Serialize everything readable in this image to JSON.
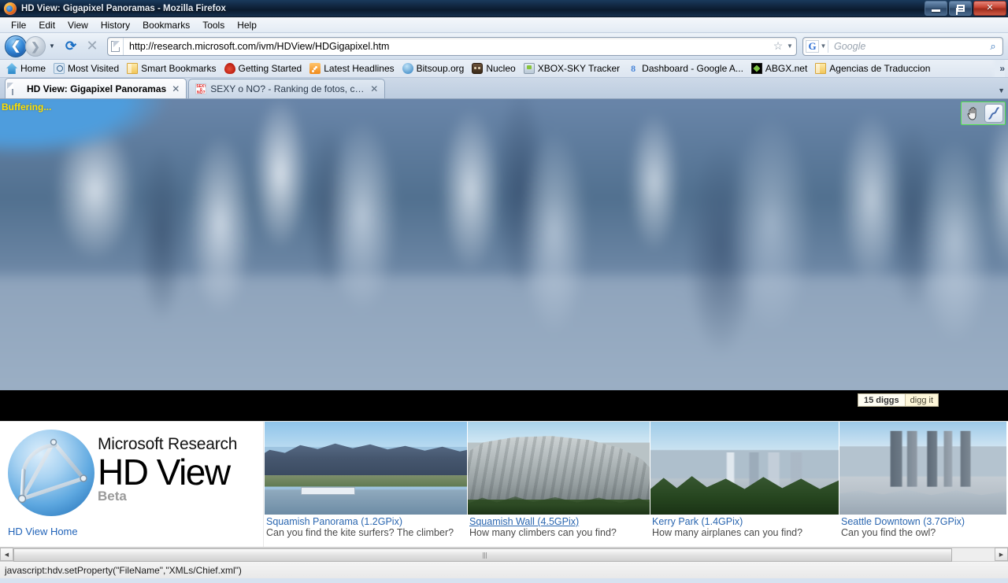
{
  "window": {
    "title": "HD View: Gigapixel Panoramas - Mozilla Firefox",
    "minimize_label": "Minimize",
    "restore_label": "Restore",
    "close_label": "✕"
  },
  "menubar": {
    "items": [
      {
        "label": "File"
      },
      {
        "label": "Edit"
      },
      {
        "label": "View"
      },
      {
        "label": "History"
      },
      {
        "label": "Bookmarks"
      },
      {
        "label": "Tools"
      },
      {
        "label": "Help"
      }
    ]
  },
  "toolbar": {
    "back_glyph": "❮",
    "forward_glyph": "❯",
    "dropdown_glyph": "▼",
    "reload_glyph": "⟳",
    "stop_glyph": "✕",
    "url": "http://research.microsoft.com/ivm/HDView/HDGigapixel.htm",
    "star_glyph": "☆",
    "star_caret": "▼",
    "search_engine": "G",
    "search_caret": "▼",
    "search_placeholder": "Google",
    "search_glyph": "⌕"
  },
  "bookmarks": {
    "items": [
      {
        "label": "Home",
        "icon": "home-icon"
      },
      {
        "label": "Most Visited",
        "icon": "magnifier-icon"
      },
      {
        "label": "Smart Bookmarks",
        "icon": "folder-icon"
      },
      {
        "label": "Getting Started",
        "icon": "flame-icon"
      },
      {
        "label": "Latest Headlines",
        "icon": "rss-icon"
      },
      {
        "label": "Bitsoup.org",
        "icon": "globe-icon"
      },
      {
        "label": "Nucleo",
        "icon": "nucleo-icon"
      },
      {
        "label": "XBOX-SKY Tracker",
        "icon": "xbox-icon"
      },
      {
        "label": "Dashboard - Google A...",
        "icon": "dashboard-icon"
      },
      {
        "label": "ABGX.net",
        "icon": "abgx-icon"
      },
      {
        "label": "Agencias de Traduccion",
        "icon": "folder-icon"
      }
    ],
    "overflow_glyph": "»"
  },
  "tabs": {
    "items": [
      {
        "label": "HD View: Gigapixel Panoramas",
        "active": true,
        "close_glyph": "✕"
      },
      {
        "label": "SEXY o NO? - Ranking de fotos, con...",
        "active": false,
        "close_glyph": "✕",
        "favicon_text": "SEXY o NO?"
      }
    ],
    "scroll_right_glyph": "▼"
  },
  "viewer": {
    "status": "Buffering...",
    "tools": [
      {
        "name": "pan-hand-tool",
        "glyph": "✋"
      },
      {
        "name": "curve-tool",
        "glyph": "curve"
      }
    ],
    "digg": {
      "count": "15 diggs",
      "button": "digg it"
    }
  },
  "brand": {
    "line1": "Microsoft Research",
    "line2": "HD View",
    "line3": "Beta",
    "home_link": "HD View Home"
  },
  "gallery": {
    "items": [
      {
        "title": "Squamish Panorama (1.2GPix)",
        "caption": "Can you find the kite surfers? The climber?",
        "underlined": false,
        "art": "img-squamish-pan"
      },
      {
        "title": "Squamish Wall (4.5GPix)",
        "caption": "How many climbers can you find?",
        "underlined": true,
        "art": "img-squamish-wall"
      },
      {
        "title": "Kerry Park (1.4GPix)",
        "caption": "How many airplanes can you find?",
        "underlined": false,
        "art": "img-kerry"
      },
      {
        "title": "Seattle Downtown (3.7GPix)",
        "caption": "Can you find the owl?",
        "underlined": false,
        "art": "img-seattle"
      }
    ]
  },
  "scrollbar": {
    "left_arrow": "◀",
    "right_arrow": "▶"
  },
  "statusbar": {
    "text": "javascript:hdv.setProperty(\"FileName\",\"XMLs/Chief.xml\")"
  }
}
